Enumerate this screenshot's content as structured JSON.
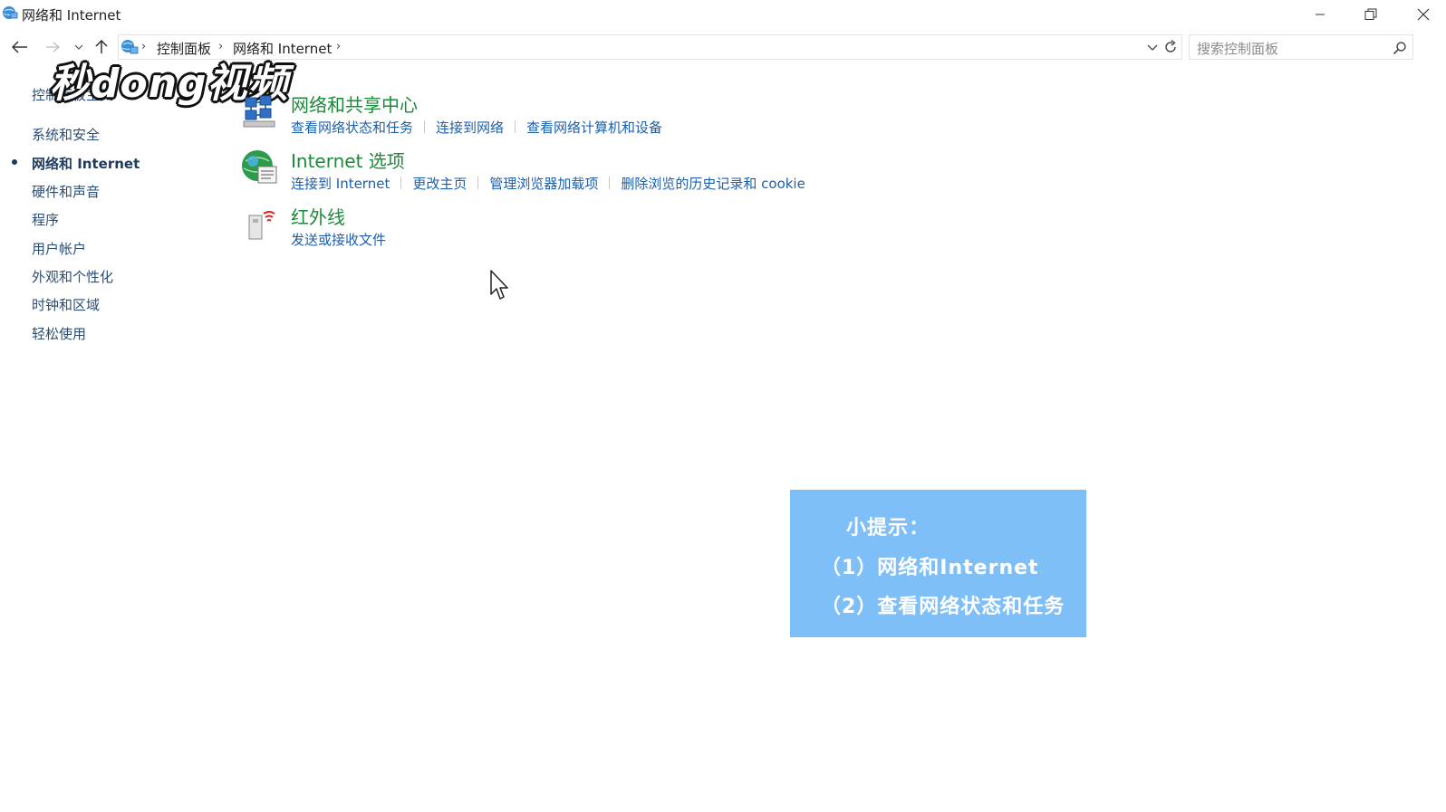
{
  "window": {
    "title": "网络和 Internet"
  },
  "address_bar": {
    "crumbs": [
      "控制面板",
      "网络和 Internet"
    ],
    "search_placeholder": "搜索控制面板"
  },
  "sidebar": {
    "home": "控制面板主页",
    "items": [
      {
        "label": "系统和安全",
        "active": false
      },
      {
        "label": "网络和 Internet",
        "active": true
      },
      {
        "label": "硬件和声音",
        "active": false
      },
      {
        "label": "程序",
        "active": false
      },
      {
        "label": "用户帐户",
        "active": false
      },
      {
        "label": "外观和个性化",
        "active": false
      },
      {
        "label": "时钟和区域",
        "active": false
      },
      {
        "label": "轻松使用",
        "active": false
      }
    ]
  },
  "categories": [
    {
      "title": "网络和共享中心",
      "icon": "network-sharing-icon",
      "links": [
        "查看网络状态和任务",
        "连接到网络",
        "查看网络计算机和设备"
      ]
    },
    {
      "title": "Internet 选项",
      "icon": "internet-options-icon",
      "links": [
        "连接到 Internet",
        "更改主页",
        "管理浏览器加载项",
        "删除浏览的历史记录和 cookie"
      ]
    },
    {
      "title": "红外线",
      "icon": "infrared-icon",
      "links": [
        "发送或接收文件"
      ]
    }
  ],
  "watermark": {
    "text": "秒dong视频"
  },
  "tip": {
    "heading": "小提示：",
    "lines": [
      "（1）网络和Internet",
      "（2）查看网络状态和任务"
    ],
    "background": "#7fbff8"
  },
  "colors": {
    "category_title": "#1b8a3a",
    "link": "#1f5fa8",
    "sidebar_text": "#2b4d73"
  }
}
